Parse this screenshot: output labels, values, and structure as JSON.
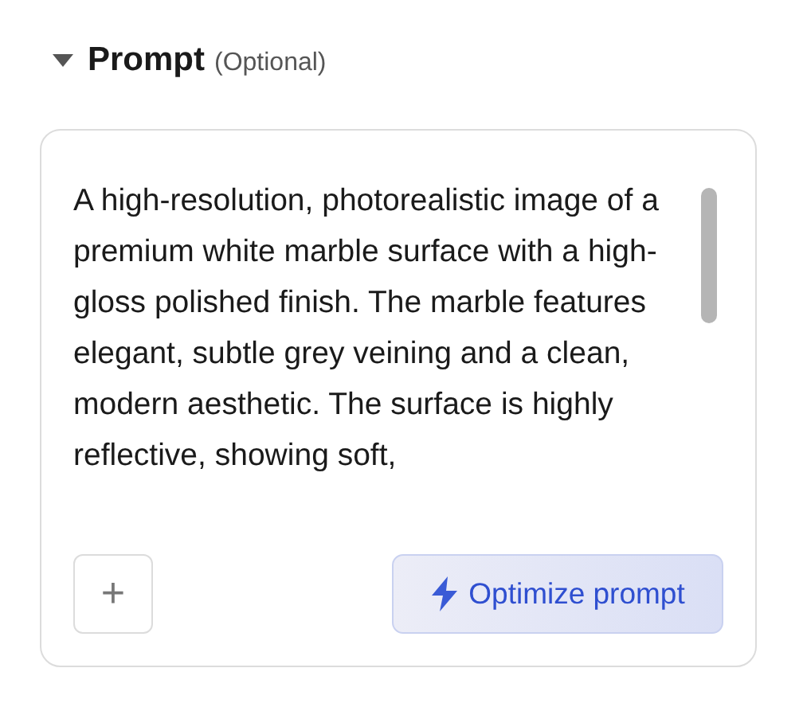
{
  "section": {
    "title": "Prompt",
    "hint": "(Optional)",
    "expanded": true
  },
  "prompt": {
    "value": "A high-resolution, photorealistic image of a premium white marble surface with a high-gloss polished finish. The marble features elegant, subtle grey veining and a clean, modern aesthetic. The surface is highly reflective, showing soft,"
  },
  "buttons": [
    {
      "kind": "add",
      "label": "+"
    },
    {
      "kind": "optimize",
      "label": "Optimize prompt"
    }
  ]
}
